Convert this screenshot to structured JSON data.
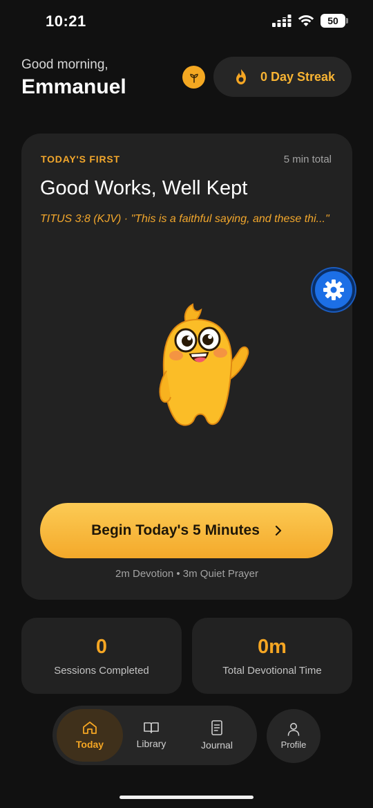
{
  "status_bar": {
    "time": "10:21",
    "battery": "50"
  },
  "header": {
    "greeting": "Good morning,",
    "name": "Emmanuel",
    "badge_icon": "seedling-icon",
    "streak": {
      "icon": "flame-icon",
      "label": "0 Day Streak"
    }
  },
  "today_card": {
    "kicker": "TODAY'S FIRST",
    "total": "5 min total",
    "title": "Good Works, Well Kept",
    "verse": "TITUS 3:8 (KJV) · \"This is a faithful saying, and these thi...\"",
    "cta_label": "Begin Today's 5 Minutes",
    "cta_icon": "chevron-right-icon",
    "breakdown": "2m Devotion • 3m Quiet Prayer"
  },
  "settings_fab": {
    "icon": "gear-icon"
  },
  "stats": [
    {
      "value": "0",
      "label": "Sessions Completed"
    },
    {
      "value": "0m",
      "label": "Total Devotional Time"
    }
  ],
  "nav": {
    "items": [
      {
        "label": "Today",
        "icon": "home-icon",
        "active": true
      },
      {
        "label": "Library",
        "icon": "book-icon",
        "active": false
      },
      {
        "label": "Journal",
        "icon": "document-icon",
        "active": false
      }
    ],
    "profile": {
      "label": "Profile",
      "icon": "person-icon"
    }
  },
  "colors": {
    "accent": "#f5a623",
    "background": "#111111",
    "card": "#222222",
    "fab": "#1c6fe6"
  }
}
